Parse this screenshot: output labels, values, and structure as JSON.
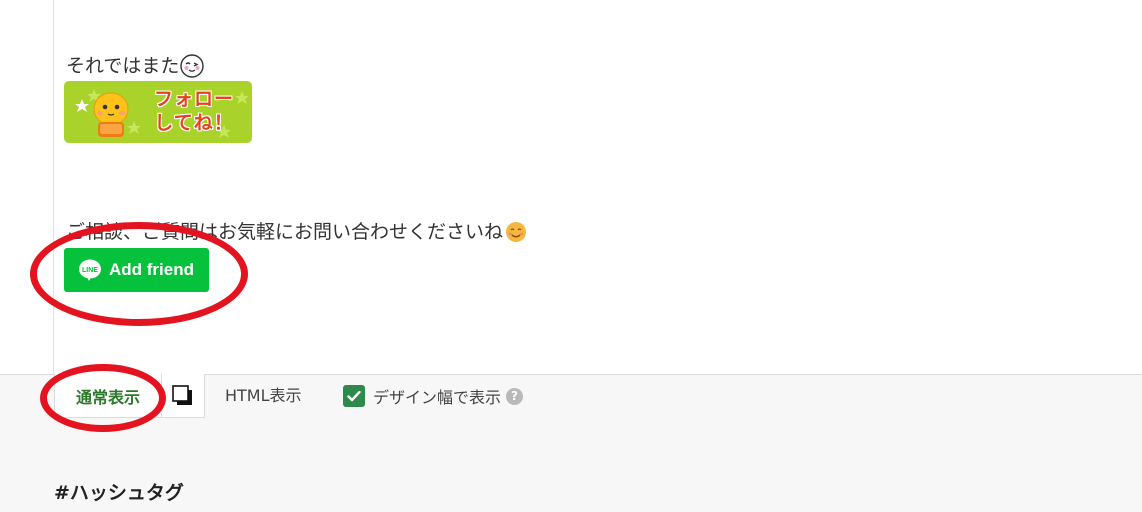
{
  "editor": {
    "line1_text": "それではまた",
    "follow_banner": {
      "line1": "フォロー",
      "line2": "してね！"
    },
    "line2_text": "ご相談、ご質問はお気軽にお問い合わせくださいね",
    "line_button_label": "Add friend",
    "line_logo_text": "LINE"
  },
  "tabs": {
    "normal_label": "通常表示",
    "html_label": "HTML表示",
    "design_width_label": "デザイン幅で表示",
    "design_width_checked": true,
    "help_glyph": "?"
  },
  "hashtag_heading": "#ハッシュタグ",
  "colors": {
    "line_green": "#06c13b",
    "annotation_red": "#e3141f",
    "active_tab_text": "#2b7a2b",
    "checkbox_green": "#2d8a4a"
  }
}
